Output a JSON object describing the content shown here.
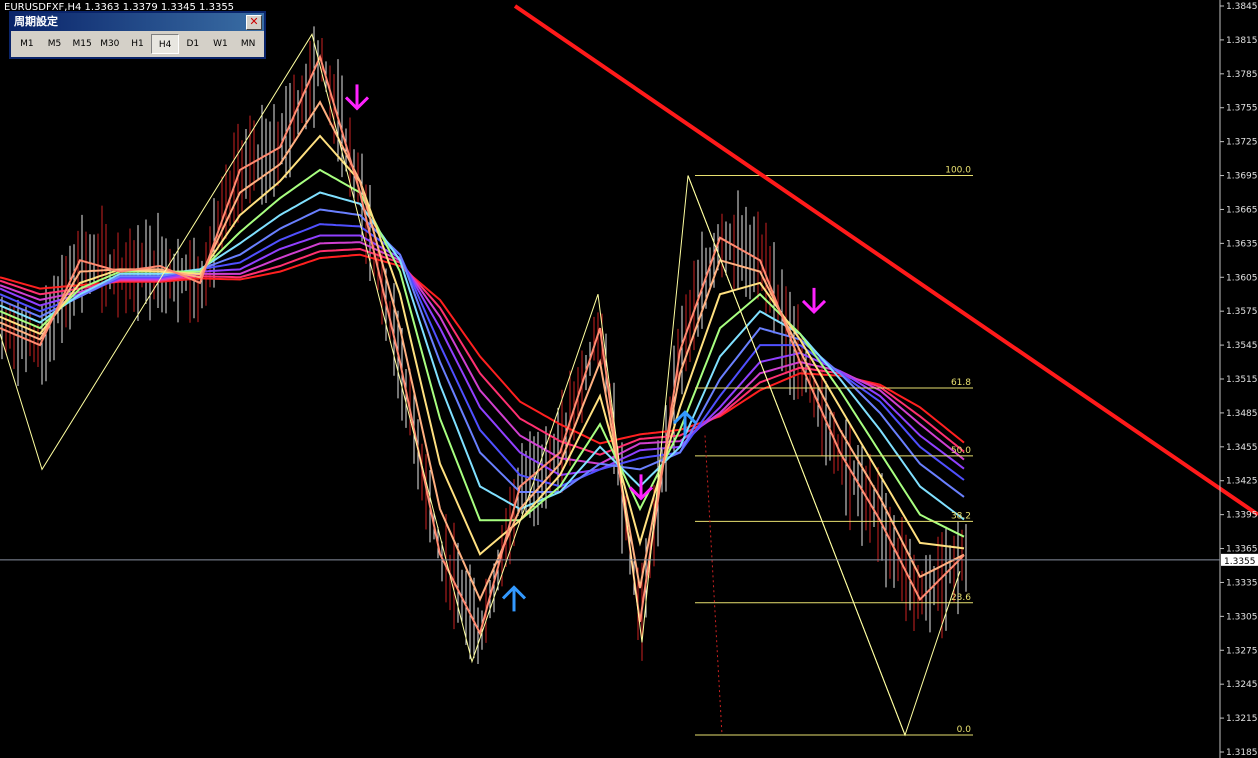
{
  "chart_header": {
    "symbol_info": "EURUSDFXF,H4  1.3363 1.3379 1.3345 1.3355"
  },
  "period_panel": {
    "title": "周期設定",
    "close_label": "✕",
    "timeframes": [
      "M1",
      "M5",
      "M15",
      "M30",
      "H1",
      "H4",
      "D1",
      "W1",
      "MN"
    ],
    "active": "H4"
  },
  "colors": {
    "background": "#000000",
    "trendline": "#ff1a1a",
    "fib": "#e8e070",
    "zigzag": "#ffffa0",
    "sell_arrow": "#ff22ff",
    "buy_arrow": "#3399ff",
    "candles": "#cc2222"
  },
  "chart_data": {
    "type": "line",
    "symbol": "EURUSDFXF",
    "timeframe": "H4",
    "ylim": [
      1.3185,
      1.3845
    ],
    "y_ticks": [
      "1.3845",
      "1.3815",
      "1.3785",
      "1.3755",
      "1.3725",
      "1.3695",
      "1.3665",
      "1.3635",
      "1.3605",
      "1.3575",
      "1.3545",
      "1.3515",
      "1.3485",
      "1.3455",
      "1.3425",
      "1.3395",
      "1.3365",
      "1.3335",
      "1.3305",
      "1.3275",
      "1.3245",
      "1.3215",
      "1.3185"
    ],
    "current_price": "1.3355",
    "fibonacci": {
      "high": 1.3695,
      "low": 1.32,
      "levels": [
        {
          "label": "100.0",
          "value": 1.3695
        },
        {
          "label": "61.8",
          "value": 1.3507
        },
        {
          "label": "50.0",
          "value": 1.3447
        },
        {
          "label": "38.2",
          "value": 1.3389
        },
        {
          "label": "23.6",
          "value": 1.3317
        },
        {
          "label": "0.0",
          "value": 1.32
        }
      ]
    },
    "zigzag": {
      "x_bar": [
        0,
        42,
        312,
        472,
        598,
        642,
        688,
        905,
        960
      ],
      "y": [
        1.3555,
        1.3435,
        1.382,
        1.3265,
        1.359,
        1.3282,
        1.3695,
        1.32,
        1.3345
      ]
    },
    "trendline": {
      "x_bar": [
        515,
        1258
      ],
      "y": [
        1.3845,
        1.3395
      ]
    },
    "signals": [
      {
        "type": "sell",
        "x_bar": 357,
        "y": 1.3765
      },
      {
        "type": "buy",
        "x_bar": 514,
        "y": 1.332
      },
      {
        "type": "sell",
        "x_bar": 641,
        "y": 1.342
      },
      {
        "type": "buy",
        "x_bar": 685,
        "y": 1.3475
      },
      {
        "type": "sell",
        "x_bar": 814,
        "y": 1.3585
      }
    ],
    "ma_ribbon": {
      "x_bar": [
        0,
        40,
        80,
        120,
        160,
        200,
        240,
        280,
        320,
        360,
        400,
        440,
        480,
        520,
        560,
        600,
        640,
        680,
        720,
        760,
        800,
        840,
        880,
        920,
        965
      ],
      "series": [
        {
          "color": "#ff8a70",
          "values": [
            1.356,
            1.3545,
            1.362,
            1.361,
            1.3615,
            1.36,
            1.37,
            1.372,
            1.38,
            1.368,
            1.353,
            1.336,
            1.329,
            1.342,
            1.345,
            1.356,
            1.33,
            1.354,
            1.364,
            1.362,
            1.353,
            1.345,
            1.339,
            1.332,
            1.336
          ]
        },
        {
          "color": "#ffb080",
          "values": [
            1.3565,
            1.355,
            1.361,
            1.3612,
            1.3612,
            1.3605,
            1.368,
            1.3705,
            1.376,
            1.369,
            1.356,
            1.34,
            1.332,
            1.34,
            1.344,
            1.353,
            1.333,
            1.352,
            1.362,
            1.361,
            1.354,
            1.347,
            1.341,
            1.334,
            1.336
          ]
        },
        {
          "color": "#ffe080",
          "values": [
            1.357,
            1.3555,
            1.36,
            1.3612,
            1.361,
            1.3608,
            1.366,
            1.369,
            1.373,
            1.369,
            1.359,
            1.344,
            1.336,
            1.339,
            1.343,
            1.35,
            1.337,
            1.349,
            1.359,
            1.36,
            1.355,
            1.349,
            1.343,
            1.337,
            1.3365
          ]
        },
        {
          "color": "#a8ff80",
          "values": [
            1.3575,
            1.356,
            1.3595,
            1.361,
            1.361,
            1.361,
            1.3645,
            1.3675,
            1.37,
            1.368,
            1.361,
            1.348,
            1.339,
            1.339,
            1.342,
            1.3475,
            1.34,
            1.347,
            1.356,
            1.359,
            1.3555,
            1.3505,
            1.345,
            1.3395,
            1.3375
          ]
        },
        {
          "color": "#80e0ff",
          "values": [
            1.358,
            1.3565,
            1.359,
            1.3608,
            1.3608,
            1.3612,
            1.3635,
            1.366,
            1.368,
            1.367,
            1.362,
            1.351,
            1.342,
            1.34,
            1.3415,
            1.3455,
            1.342,
            1.3455,
            1.3535,
            1.3575,
            1.3555,
            1.3515,
            1.347,
            1.342,
            1.339
          ]
        },
        {
          "color": "#6a80ff",
          "values": [
            1.3585,
            1.357,
            1.3588,
            1.3606,
            1.3606,
            1.3612,
            1.3625,
            1.3648,
            1.3665,
            1.366,
            1.3625,
            1.353,
            1.345,
            1.3415,
            1.3415,
            1.344,
            1.3435,
            1.345,
            1.3515,
            1.356,
            1.355,
            1.352,
            1.3485,
            1.344,
            1.341
          ]
        },
        {
          "color": "#5050ff",
          "values": [
            1.359,
            1.3575,
            1.3588,
            1.3605,
            1.3605,
            1.3612,
            1.3618,
            1.3638,
            1.3652,
            1.365,
            1.3625,
            1.3545,
            1.347,
            1.343,
            1.342,
            1.3435,
            1.3445,
            1.345,
            1.35,
            1.3545,
            1.3545,
            1.352,
            1.3495,
            1.3455,
            1.3425
          ]
        },
        {
          "color": "#9040ff",
          "values": [
            1.3595,
            1.358,
            1.359,
            1.3604,
            1.3604,
            1.361,
            1.3612,
            1.363,
            1.3642,
            1.3642,
            1.3622,
            1.356,
            1.349,
            1.345,
            1.343,
            1.3435,
            1.3452,
            1.3455,
            1.349,
            1.353,
            1.3538,
            1.3522,
            1.35,
            1.3465,
            1.3435
          ]
        },
        {
          "color": "#d040d0",
          "values": [
            1.3598,
            1.3585,
            1.3592,
            1.3603,
            1.3603,
            1.3608,
            1.3608,
            1.3622,
            1.3635,
            1.3636,
            1.362,
            1.357,
            1.3505,
            1.3465,
            1.3445,
            1.344,
            1.3458,
            1.346,
            1.3485,
            1.352,
            1.353,
            1.3522,
            1.3505,
            1.3475,
            1.3443
          ]
        },
        {
          "color": "#ff3070",
          "values": [
            1.3602,
            1.359,
            1.3595,
            1.3602,
            1.3602,
            1.3606,
            1.3605,
            1.3615,
            1.3628,
            1.363,
            1.3618,
            1.3578,
            1.352,
            1.348,
            1.346,
            1.3448,
            1.3462,
            1.3465,
            1.3483,
            1.3512,
            1.3525,
            1.352,
            1.3508,
            1.3482,
            1.345
          ]
        },
        {
          "color": "#ff2020",
          "values": [
            1.3605,
            1.3595,
            1.3598,
            1.3601,
            1.3601,
            1.3604,
            1.3603,
            1.361,
            1.3622,
            1.3625,
            1.3615,
            1.3585,
            1.3535,
            1.3495,
            1.3475,
            1.3458,
            1.3466,
            1.347,
            1.3482,
            1.3505,
            1.352,
            1.3518,
            1.351,
            1.349,
            1.3458
          ]
        }
      ]
    }
  }
}
